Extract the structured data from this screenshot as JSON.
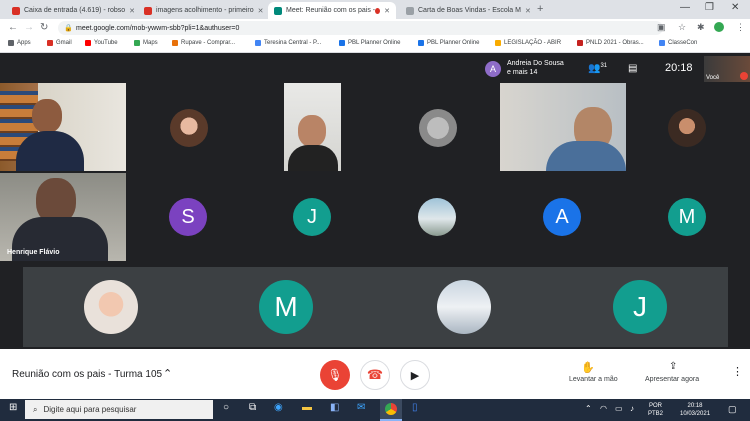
{
  "browser": {
    "tabs": [
      {
        "title": "Caixa de entrada (4.619) - robso",
        "icon_color": "#d93025"
      },
      {
        "title": "imagens acolhimento - primeiro",
        "icon_color": "#d93025"
      },
      {
        "title": "Meet: Reunião com os pais -",
        "icon_color": "#00897b"
      },
      {
        "title": "Carta de Boas Vindas - Escola M",
        "icon_color": "#9aa0a6"
      }
    ],
    "url": "meet.google.com/mob-ywwm-sbb?pli=1&authuser=0",
    "bookmarks": [
      {
        "label": "Apps",
        "color": "#5f6368"
      },
      {
        "label": "Gmail",
        "color": "#d93025"
      },
      {
        "label": "YouTube",
        "color": "#ff0000"
      },
      {
        "label": "Maps",
        "color": "#34a853"
      },
      {
        "label": "Rupave - Comprar...",
        "color": "#e8710a"
      },
      {
        "label": "Teresina Central - P...",
        "color": "#4285f4"
      },
      {
        "label": "PBL Planner Online",
        "color": "#1a73e8"
      },
      {
        "label": "PBL Planner Online",
        "color": "#1a73e8"
      },
      {
        "label": "LEGISLAÇÃO - ABIR",
        "color": "#f9ab00"
      },
      {
        "label": "PNLD 2021 - Obras...",
        "color": "#c5221f"
      },
      {
        "label": "ClasseCon",
        "color": "#4285f4"
      }
    ]
  },
  "meet": {
    "presenter": {
      "name": "Andreia Do Sousa",
      "others": "e mais 14",
      "initial": "A"
    },
    "participant_count": "31",
    "clock": "20:18",
    "self_label": "Você",
    "speaker_name": "Henrique Flávio",
    "avatars": [
      {
        "initial": "S",
        "color": "#7b42c0"
      },
      {
        "initial": "J",
        "color": "#129e8f"
      },
      {
        "initial": "A",
        "color": "#1a73e8"
      },
      {
        "initial": "M",
        "color": "#129e8f"
      },
      {
        "initial": "M",
        "color": "#129e8f"
      },
      {
        "initial": "J",
        "color": "#129e8f"
      }
    ],
    "meeting_title": "Reunião com os pais - Turma 105",
    "raise_hand_label": "Levantar a mão",
    "present_label": "Apresentar agora"
  },
  "taskbar": {
    "search_placeholder": "Digite aqui para pesquisar",
    "lang": "POR",
    "layout": "PTB2",
    "time": "20:18",
    "date": "10/03/2021"
  }
}
